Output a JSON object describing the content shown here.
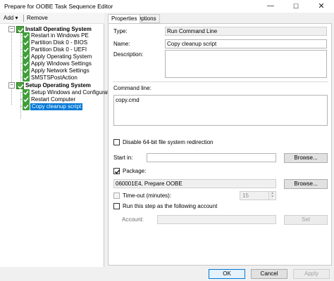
{
  "window": {
    "title": "Prepare for OOBE Task Sequence Editor",
    "min_glyph": "—",
    "max_glyph": "☐",
    "close_glyph": "✕"
  },
  "toolbar": {
    "add_label": "Add ▾",
    "remove_label": "Remove"
  },
  "tree": {
    "groups": [
      {
        "label": "Install Operating System",
        "expander": "−",
        "items": [
          "Restart in Windows PE",
          "Partition Disk 0 - BIOS",
          "Partition Disk 0 - UEFI",
          "Apply Operating System",
          "Apply Windows Settings",
          "Apply Network Settings",
          "SMSTSPostAction"
        ]
      },
      {
        "label": "Setup Operating System",
        "expander": "−",
        "items": [
          "Setup Windows and Configuration",
          "Restart Computer",
          "Copy cleanup script"
        ]
      }
    ],
    "selected": "Copy cleanup script"
  },
  "tabs": {
    "properties": "Properties",
    "options": "Options"
  },
  "properties": {
    "type_label": "Type:",
    "type_value": "Run Command Line",
    "name_label": "Name:",
    "name_value": "Copy cleanup script",
    "description_label": "Description:",
    "description_value": "",
    "command_line_label": "Command line:",
    "command_line_value": "copy.cmd",
    "disable_64bit_label": "Disable 64-bit file system redirection",
    "disable_64bit_checked": false,
    "start_in_label": "Start in:",
    "start_in_value": "",
    "browse_label": "Browse...",
    "package_label": "Package:",
    "package_checked": true,
    "package_value": "060001E4, Prepare OOBE",
    "timeout_label": "Time-out (minutes):",
    "timeout_checked": false,
    "timeout_value": "15",
    "run_as_label": "Run this step as the following account",
    "run_as_checked": false,
    "account_label": "Account:",
    "account_value": "",
    "set_label": "Set"
  },
  "footer": {
    "ok_label": "OK",
    "cancel_label": "Cancel",
    "apply_label": "Apply"
  },
  "colors": {
    "selection": "#0078d7",
    "step_icon": "#3f9e39"
  }
}
